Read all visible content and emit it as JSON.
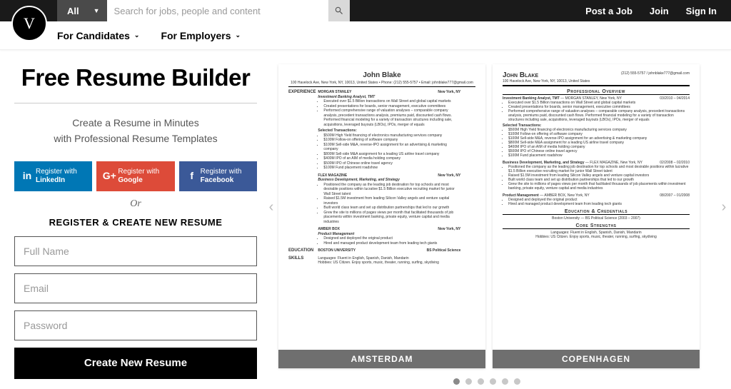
{
  "topbar": {
    "all_label": "All",
    "search_placeholder": "Search for jobs, people and content",
    "post_job": "Post a Job",
    "join": "Join",
    "sign_in": "Sign In"
  },
  "logo_letter": "V",
  "nav": {
    "candidates": "For Candidates",
    "employers": "For Employers"
  },
  "hero": {
    "title": "Free Resume Builder",
    "tagline1": "Create a Resume in Minutes",
    "tagline2": "with Professional Resume Templates"
  },
  "social": {
    "linkedin_line1": "Register with",
    "linkedin_line2": "LinkedIn",
    "google_line1": "Register with",
    "google_line2": "Google",
    "facebook_line1": "Register with",
    "facebook_line2": "Facebook"
  },
  "or": "Or",
  "register_heading": "REGISTER & CREATE NEW RESUME",
  "form": {
    "name_ph": "Full Name",
    "email_ph": "Email",
    "password_ph": "Password",
    "submit": "Create New Resume"
  },
  "templates": [
    {
      "label": "AMSTERDAM"
    },
    {
      "label": "COPENHAGEN"
    }
  ],
  "resume": {
    "name": "John Blake",
    "contact": "100 Havelock Ave, New York, NY, 10013, United States • Phone: (212) 555-5757 • Email: johnblake777@gmail.com",
    "phone": "(212) 555-5757",
    "email": "johnblake777@gmail.com",
    "addr_short": "100 Havelock Ave, New York, NY, 10013, United States",
    "sections": {
      "experience": "EXPERIENCE",
      "education": "EDUCATION",
      "skills": "SKILLS",
      "overview": "Professional Overview",
      "edu_cred": "Education & Credentials",
      "core": "Core Strengths"
    },
    "jobs": [
      {
        "company": "MORGAN STANLEY",
        "location": "New York, NY",
        "dates": "03/2010 – 04/2014",
        "role": "Investment Banking Analyst, TMT",
        "bullets": [
          "Executed over $1.5 Billion transactions on Wall Street and global capital markets",
          "Created presentations for boards, senior management, executive committees",
          "Performed comprehensive range of valuation analyses – comparable company analysis, precedent transactions analysis, premiums paid, discounted cash flows. Performed financial modeling for a variety of transaction structures including sale, acquisitions, leveraged buyouts (LBOs), IPOs, merger of equals"
        ],
        "selected": "Selected Transactions:",
        "deals": [
          "$500M High Yield financing of electronics manufacturing services company",
          "$100M Follow-on offering of software company",
          "$100M Sell-side M&A, reverse-IPO assignment for an advertising & marketing company",
          "$800M Sell-side M&A assignment for a leading US airline travel company",
          "$400M IPO of an AIM of media holding company",
          "$500M IPO of Chinese online travel agency",
          "$100M Fund placement roadshow"
        ]
      },
      {
        "company": "FLEX MAGAZINE",
        "location": "New York, NY",
        "dates": "02/2008 – 02/2010",
        "role": "Business Development, Marketing, and Strategy",
        "bullets": [
          "Positioned the company as the leading job destination for top schools and most desirable positions within lucrative $1.5 Billion executive recruiting market for junior Wall Street talent",
          "Raised $1.5M investment from leading Silicon Valley angels and venture capital investors",
          "Built world class team and set up distribution partnerships that led to our growth",
          "Grew the site to millions of pages views per month that facilitated thousands of job placements within investment banking, private equity, venture capital and media industries"
        ]
      },
      {
        "company": "AMBER BOX",
        "location": "New York, NY",
        "dates": "08/2007 – 01/2008",
        "role": "Product Management",
        "bullets": [
          "Designed and deployed the original product",
          "Hired and managed product development team from leading tech giants"
        ]
      }
    ],
    "edu": {
      "school": "BOSTON UNIVERSITY",
      "dates": "2003 – 2007",
      "degree": "BS Political Science",
      "cp_line": "Boston University — BS Political Science (2003 – 2007)"
    },
    "skills": {
      "languages": "Languages: Fluent in English, Spanish, Danish, Mandarin",
      "hobbies": "Hobbies: US Citizen. Enjoy sports, music, theater, running, surfing, skydiving"
    }
  },
  "dots": {
    "count": 6,
    "active": 0
  }
}
